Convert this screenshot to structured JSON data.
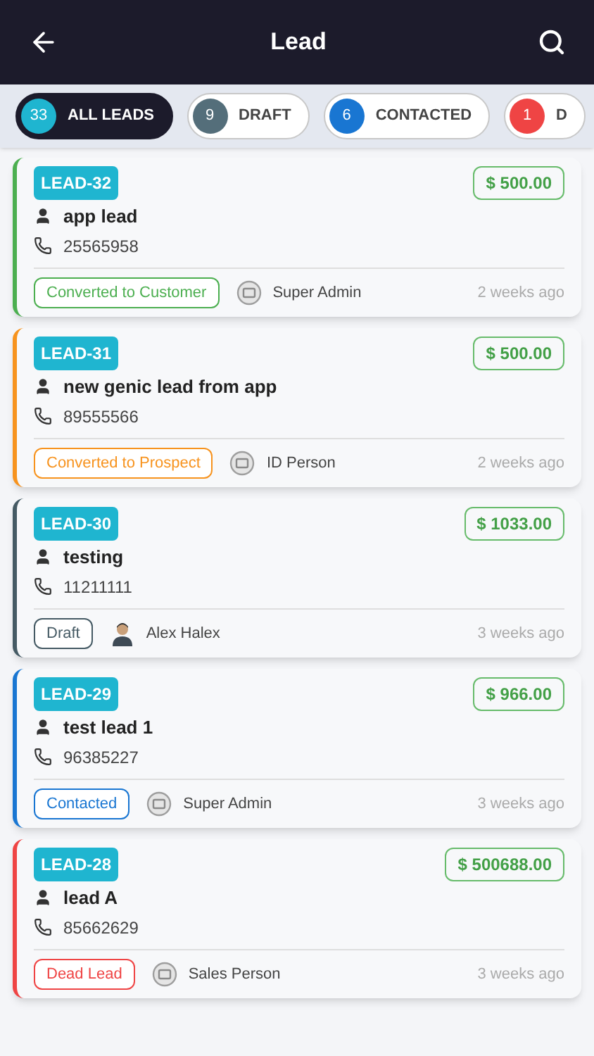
{
  "header": {
    "title": "Lead"
  },
  "filters": [
    {
      "count": "33",
      "label": "ALL LEADS",
      "color": "#1fb5d0",
      "selected": true
    },
    {
      "count": "9",
      "label": "DRAFT",
      "color": "#546e7a",
      "selected": false
    },
    {
      "count": "6",
      "label": "CONTACTED",
      "color": "#1976d2",
      "selected": false
    },
    {
      "count": "1",
      "label": "D",
      "color": "#ef4444",
      "selected": false
    }
  ],
  "leads": [
    {
      "code": "LEAD-32",
      "amount": "$ 500.00",
      "name": "app lead",
      "phone": "25565958",
      "status": "Converted to Customer",
      "color": "#4caf50",
      "owner": "Super Admin",
      "avatar": {
        "kind": "icon"
      },
      "time": "2 weeks ago"
    },
    {
      "code": "LEAD-31",
      "amount": "$ 500.00",
      "name": "new genic lead from app",
      "phone": "89555566",
      "status": "Converted to Prospect",
      "color": "#f7931e",
      "owner": "ID Person",
      "avatar": {
        "kind": "icon"
      },
      "time": "2 weeks ago"
    },
    {
      "code": "LEAD-30",
      "amount": "$ 1033.00",
      "name": "testing",
      "phone": "11211111",
      "status": "Draft",
      "color": "#455a64",
      "owner": "Alex Halex",
      "avatar": {
        "kind": "photo"
      },
      "time": "3 weeks ago"
    },
    {
      "code": "LEAD-29",
      "amount": "$ 966.00",
      "name": "test lead 1",
      "phone": "96385227",
      "status": "Contacted",
      "color": "#1976d2",
      "owner": "Super Admin",
      "avatar": {
        "kind": "icon"
      },
      "time": "3 weeks ago"
    },
    {
      "code": "LEAD-28",
      "amount": "$ 500688.00",
      "name": "lead A",
      "phone": "85662629",
      "status": "Dead Lead",
      "color": "#ef4444",
      "owner": "Sales Person",
      "avatar": {
        "kind": "icon"
      },
      "time": "3 weeks ago"
    }
  ]
}
